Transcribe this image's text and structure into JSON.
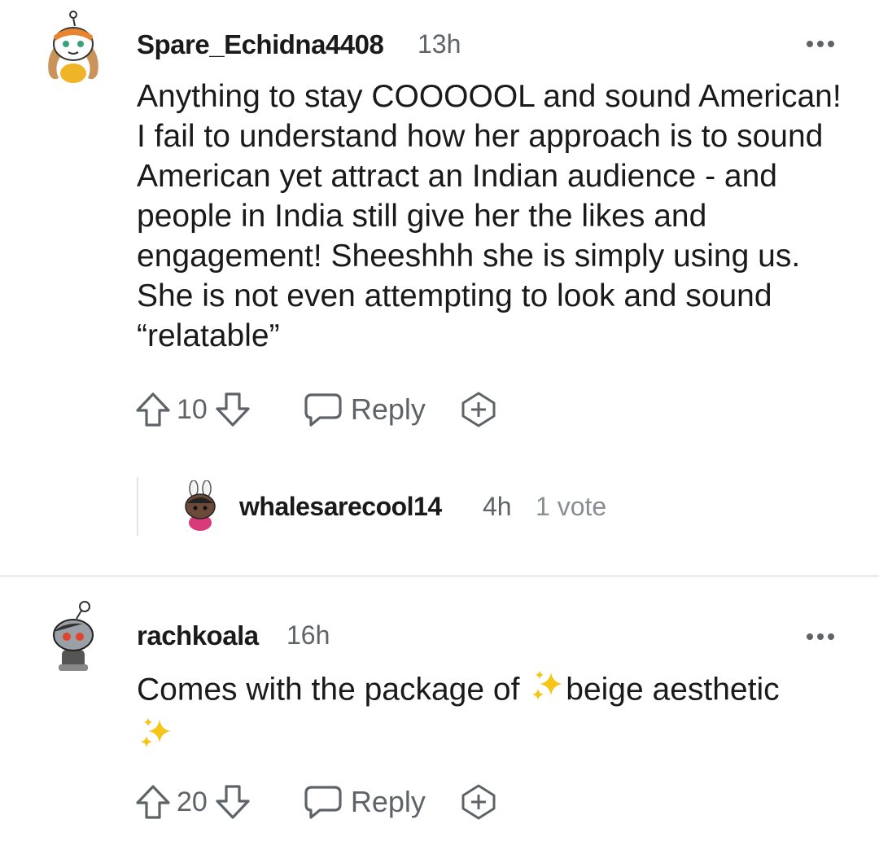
{
  "comments": [
    {
      "username": "Spare_Echidna4408",
      "time": "13h",
      "body": "Anything to stay COOOOOL and sound American! I fail to understand how her approach is to sound American yet attract an Indian audience - and people in India still give her the likes and engagement! Sheeshhh she is simply using us. She is not even attempting to look and sound “relatable”",
      "votes": "10",
      "reply_label": "Reply",
      "avatar_icon": "snoo-avatar-orange-bandana",
      "child": {
        "username": "whalesarecool14",
        "time": "4h",
        "votes_text": "1 vote",
        "avatar_icon": "snoo-avatar-bunny-ears"
      }
    },
    {
      "username": "rachkoala",
      "time": "16h",
      "body_before": "Comes with the package of ",
      "body_after": "beige aesthetic",
      "sparkle_icon": "sparkles-emoji",
      "votes": "20",
      "reply_label": "Reply",
      "avatar_icon": "snoo-avatar-grey-red-eyes"
    }
  ],
  "colors": {
    "text": "#1a1a1b",
    "meta": "#5f6368",
    "divider": "#ededed",
    "sparkle": "#f5c518"
  }
}
